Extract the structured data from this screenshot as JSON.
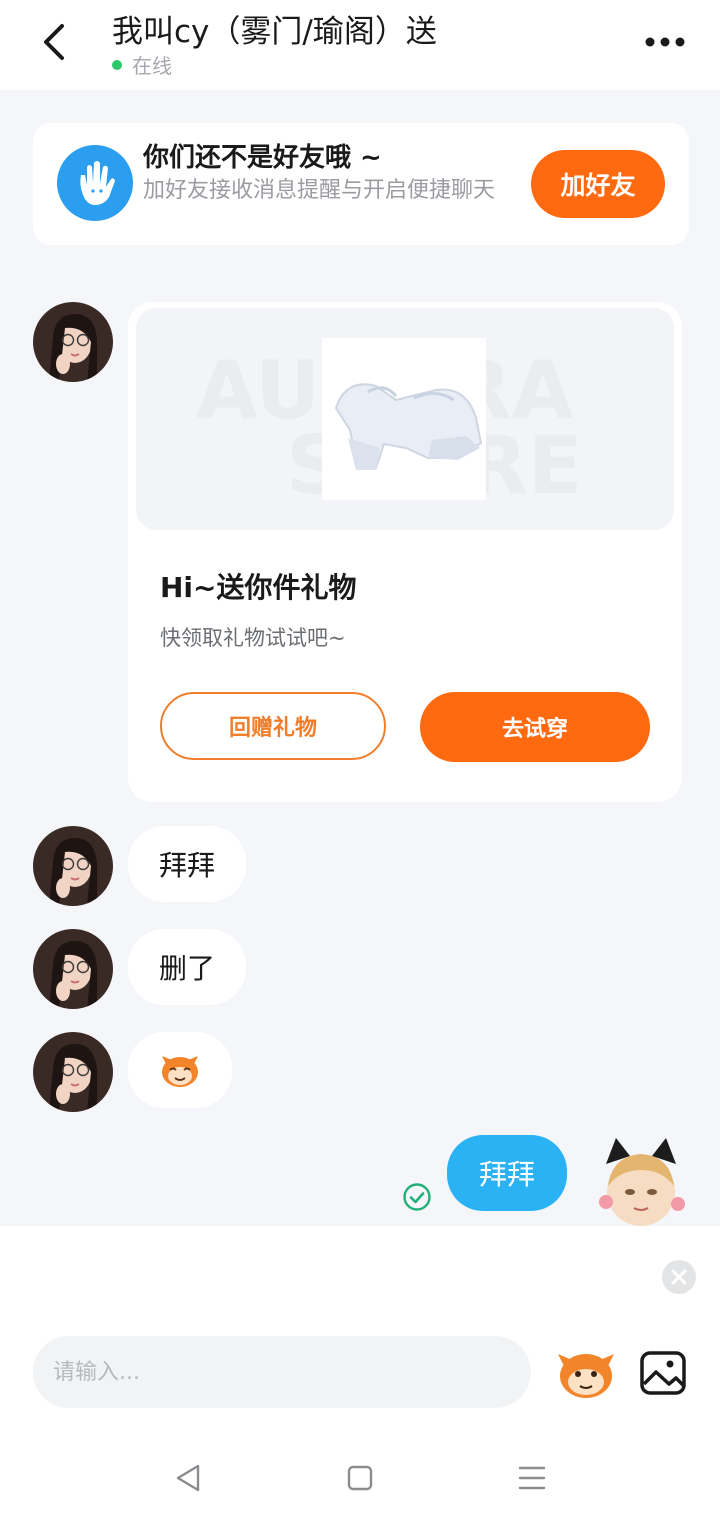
{
  "header": {
    "title": "我叫cy（雾门/瑜阁）送",
    "status": "在线",
    "status_color": "#2fc76b"
  },
  "friend_banner": {
    "title": "你们还不是好友哦 ~",
    "subtitle": "加好友接收消息提醒与开启便捷聊天",
    "button": "加好友"
  },
  "gift_card": {
    "image_text_top": "AURORA",
    "image_text_bottom": "STORE",
    "title": "Hi~送你件礼物",
    "subtitle": "快领取礼物试试吧~",
    "return_button": "回赠礼物",
    "try_button": "去试穿"
  },
  "messages": [
    {
      "sender": "other",
      "text": "拜拜"
    },
    {
      "sender": "other",
      "text": "删了"
    },
    {
      "sender": "other",
      "type": "emoji",
      "icon": "monkey-face-icon"
    },
    {
      "sender": "self",
      "text": "拜拜",
      "status": "sent"
    }
  ],
  "input": {
    "placeholder": "请输入..."
  },
  "colors": {
    "accent_orange": "#ff6a10",
    "self_bubble": "#2bb2f5",
    "background": "#f4f6f9"
  }
}
